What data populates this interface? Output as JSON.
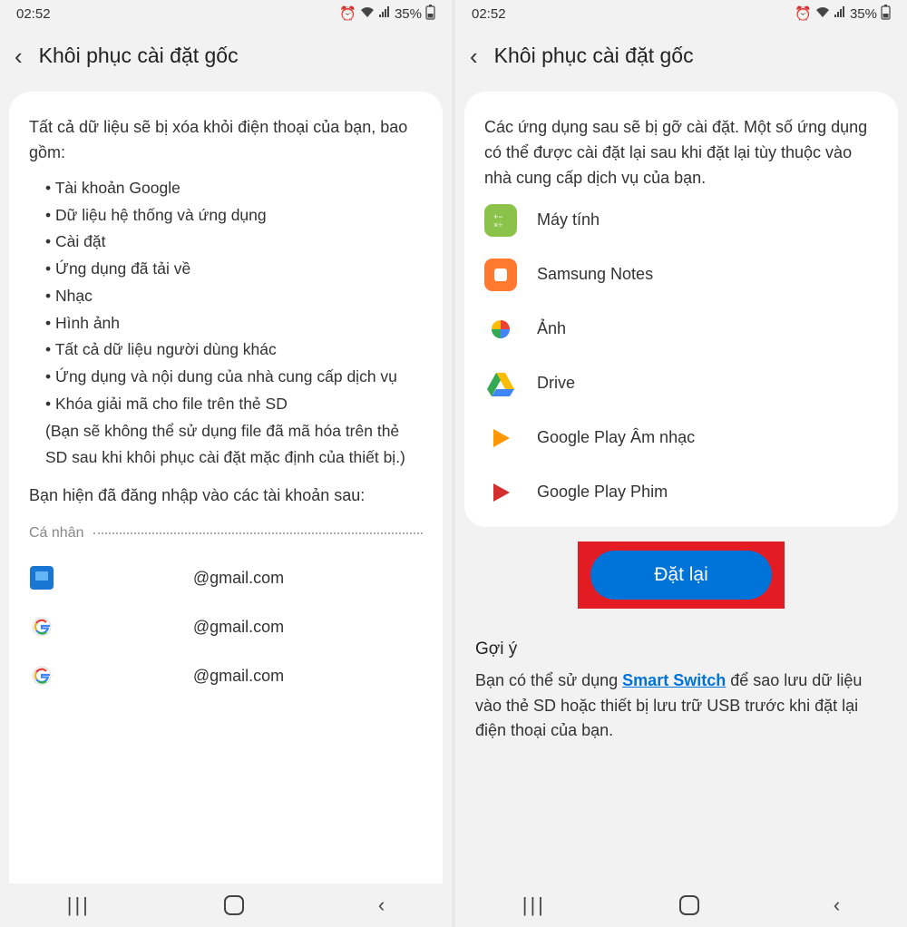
{
  "status": {
    "time": "02:52",
    "battery": "35%"
  },
  "title": "Khôi phục cài đặt gốc",
  "left": {
    "desc": "Tất cả dữ liệu sẽ bị xóa khỏi điện thoại của bạn, bao gồm:",
    "bullets": [
      "Tài khoản Google",
      "Dữ liệu hệ thống và ứng dụng",
      "Cài đặt",
      "Ứng dụng đã tải về",
      "Nhạc",
      "Hình ảnh",
      "Tất cả dữ liệu người dùng khác",
      "Ứng dụng và nội dung của nhà cung cấp dịch vụ",
      "Khóa giải mã cho file trên thẻ SD"
    ],
    "sd_note": "(Bạn sẽ không thể sử dụng file đã mã hóa trên thẻ SD sau khi khôi phục cài đặt mặc định của thiết bị.)",
    "signed_in": "Bạn hiện đã đăng nhập vào các tài khoản sau:",
    "personal_label": "Cá nhân",
    "accounts": [
      "@gmail.com",
      "@gmail.com",
      "@gmail.com"
    ]
  },
  "right": {
    "desc": "Các ứng dụng sau sẽ bị gỡ cài đặt. Một số ứng dụng có thể được cài đặt lại sau khi đặt lại tùy thuộc vào nhà cung cấp dịch vụ của bạn.",
    "apps": [
      {
        "name": "Máy tính"
      },
      {
        "name": "Samsung Notes"
      },
      {
        "name": "Ảnh"
      },
      {
        "name": "Drive"
      },
      {
        "name": "Google Play Âm nhạc"
      },
      {
        "name": "Google Play Phim"
      }
    ],
    "reset_label": "Đặt lại",
    "suggest_title": "Gợi ý",
    "suggest_before": "Bạn có thể sử dụng ",
    "suggest_link": "Smart Switch",
    "suggest_after": " để sao lưu dữ liệu vào thẻ SD hoặc thiết bị lưu trữ USB trước khi đặt lại điện thoại của bạn."
  }
}
